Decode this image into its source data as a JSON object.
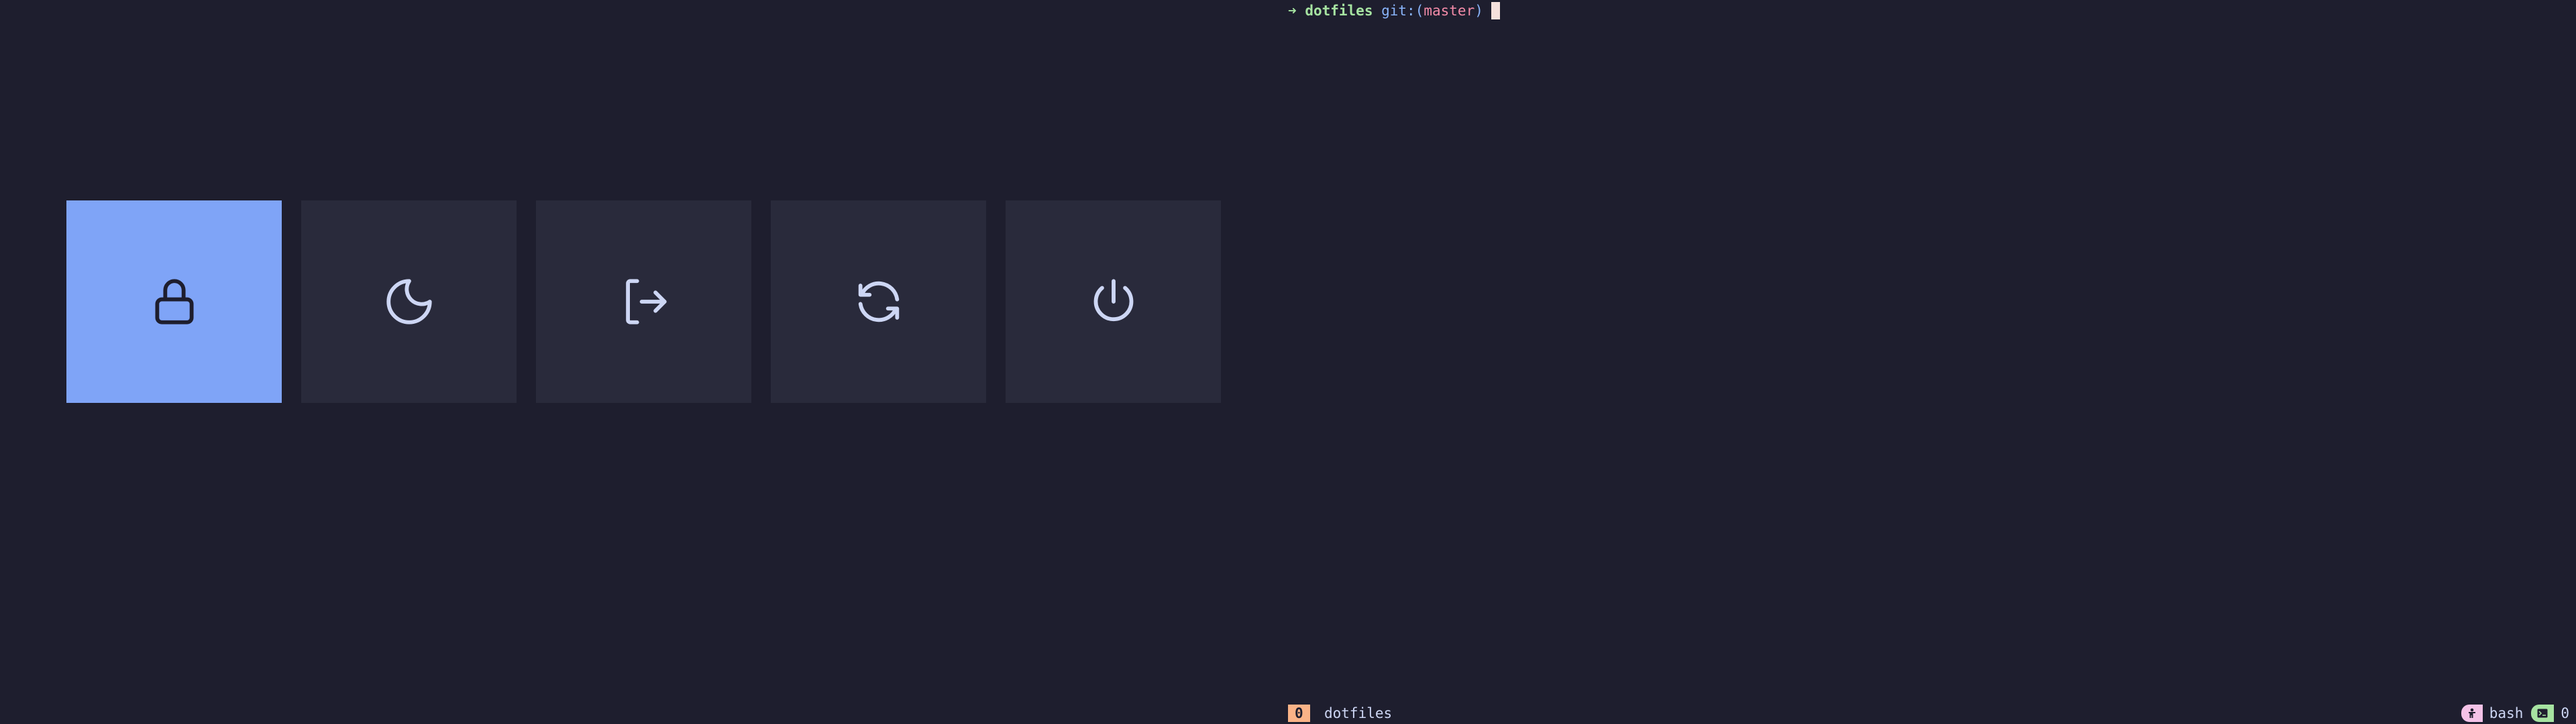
{
  "power_menu": {
    "buttons": [
      {
        "id": "lock",
        "icon": "lock-icon",
        "active": true
      },
      {
        "id": "suspend",
        "icon": "moon-icon",
        "active": false
      },
      {
        "id": "logout",
        "icon": "logout-icon",
        "active": false
      },
      {
        "id": "reboot",
        "icon": "refresh-icon",
        "active": false
      },
      {
        "id": "shutdown",
        "icon": "power-icon",
        "active": false
      }
    ],
    "colors": {
      "background": "#1e1e2e",
      "button": "#292a3b",
      "active": "#7fa4f7",
      "icon": "#cdd6f4",
      "active_icon": "#1e1e2e"
    }
  },
  "terminal": {
    "prompt": {
      "arrow": "➜",
      "directory": "dotfiles",
      "git_label": "git:",
      "paren_open": "(",
      "branch": "master",
      "paren_close": ")"
    }
  },
  "statusbar": {
    "tab_index": "0",
    "tab_name": "dotfiles",
    "shell": "bash",
    "right_count": "0",
    "shell_icon": "person-icon",
    "terminal_icon": "terminal-icon"
  }
}
